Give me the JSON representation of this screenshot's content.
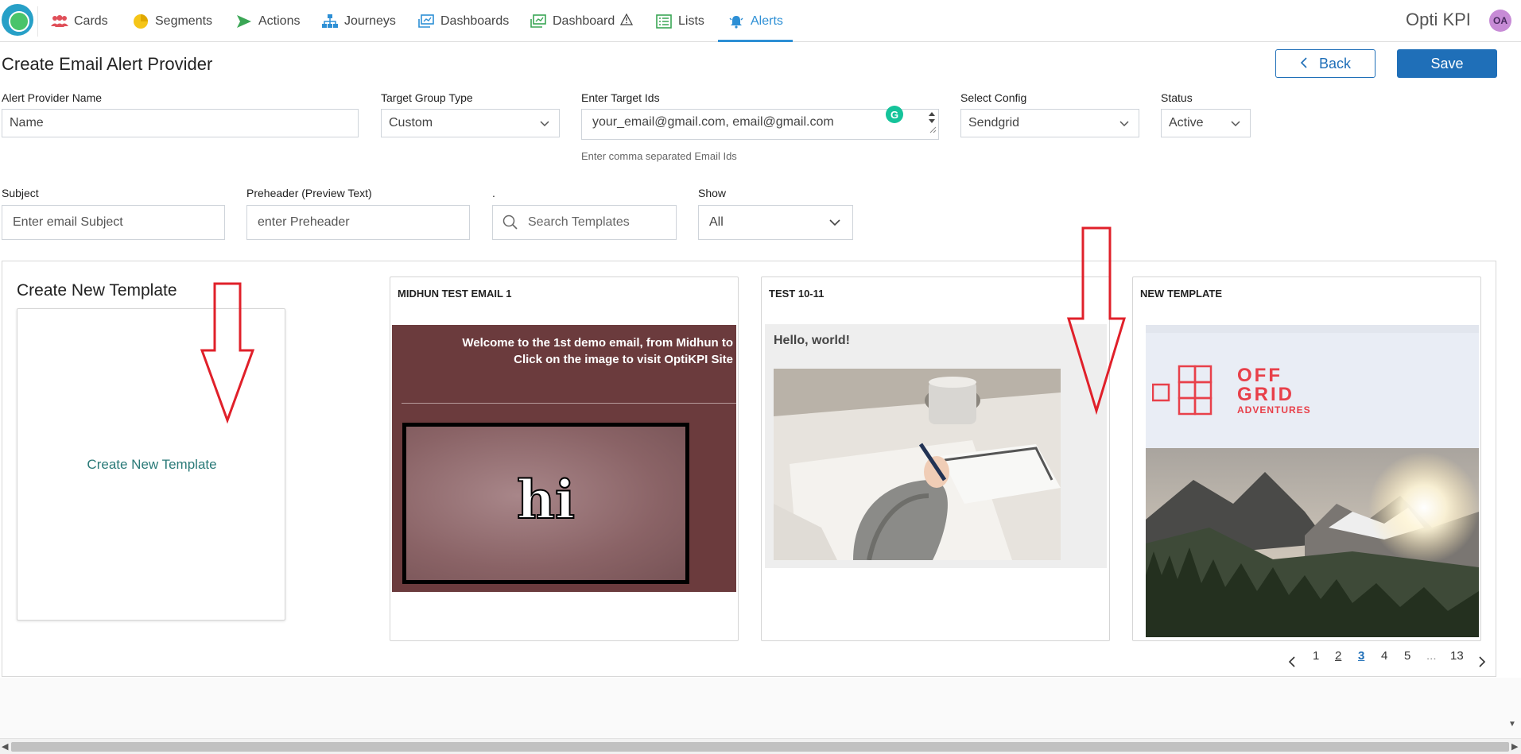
{
  "nav": {
    "items": [
      {
        "label": "Cards",
        "icon": "users-icon"
      },
      {
        "label": "Segments",
        "icon": "pie-chart-icon"
      },
      {
        "label": "Actions",
        "icon": "send-icon"
      },
      {
        "label": "Journeys",
        "icon": "sitemap-icon"
      },
      {
        "label": "Dashboards",
        "icon": "dashboard-icon"
      },
      {
        "label": "Dashboard",
        "icon": "dashboard-icon"
      },
      {
        "label": "Lists",
        "icon": "list-icon"
      },
      {
        "label": "Alerts",
        "icon": "bell-icon"
      }
    ],
    "active": "Alerts",
    "brand": "Opti KPI",
    "avatar": "OA",
    "accent": "#2d8fd5"
  },
  "header": {
    "title": "Create Email Alert Provider",
    "back_label": "Back",
    "save_label": "Save"
  },
  "form": {
    "provider_name": {
      "label": "Alert Provider Name",
      "value": "Name"
    },
    "target_group_type": {
      "label": "Target Group Type",
      "value": "Custom"
    },
    "target_ids": {
      "label": "Enter Target Ids",
      "value": "your_email@gmail.com, email@gmail.com",
      "hint": "Enter comma separated Email Ids"
    },
    "select_config": {
      "label": "Select Config",
      "value": "Sendgrid"
    },
    "status": {
      "label": "Status",
      "value": "Active"
    },
    "subject": {
      "label": "Subject",
      "placeholder": "Enter email Subject"
    },
    "preheader": {
      "label": "Preheader (Preview Text)",
      "placeholder": "enter Preheader"
    },
    "search": {
      "label": ".",
      "placeholder": "Search Templates"
    },
    "show": {
      "label": "Show",
      "value": "All"
    }
  },
  "templates": {
    "create_heading": "Create New Template",
    "create_link": "Create New Template",
    "cards": [
      {
        "title": "MIDHUN TEST EMAIL 1",
        "line1": "Welcome to the 1st demo email, from Midhun to",
        "line2": "Click on the image to visit OptiKPI Site",
        "image_text": "hi"
      },
      {
        "title": "TEST 10-11",
        "greeting": "Hello, world!"
      },
      {
        "title": "NEW TEMPLATE",
        "logo_line1": "OFF",
        "logo_line2": "GRID",
        "logo_line3": "ADVENTURES"
      }
    ]
  },
  "pager": {
    "pages": [
      "1",
      "2",
      "3",
      "4",
      "5",
      "...",
      "13"
    ],
    "current": "3"
  }
}
